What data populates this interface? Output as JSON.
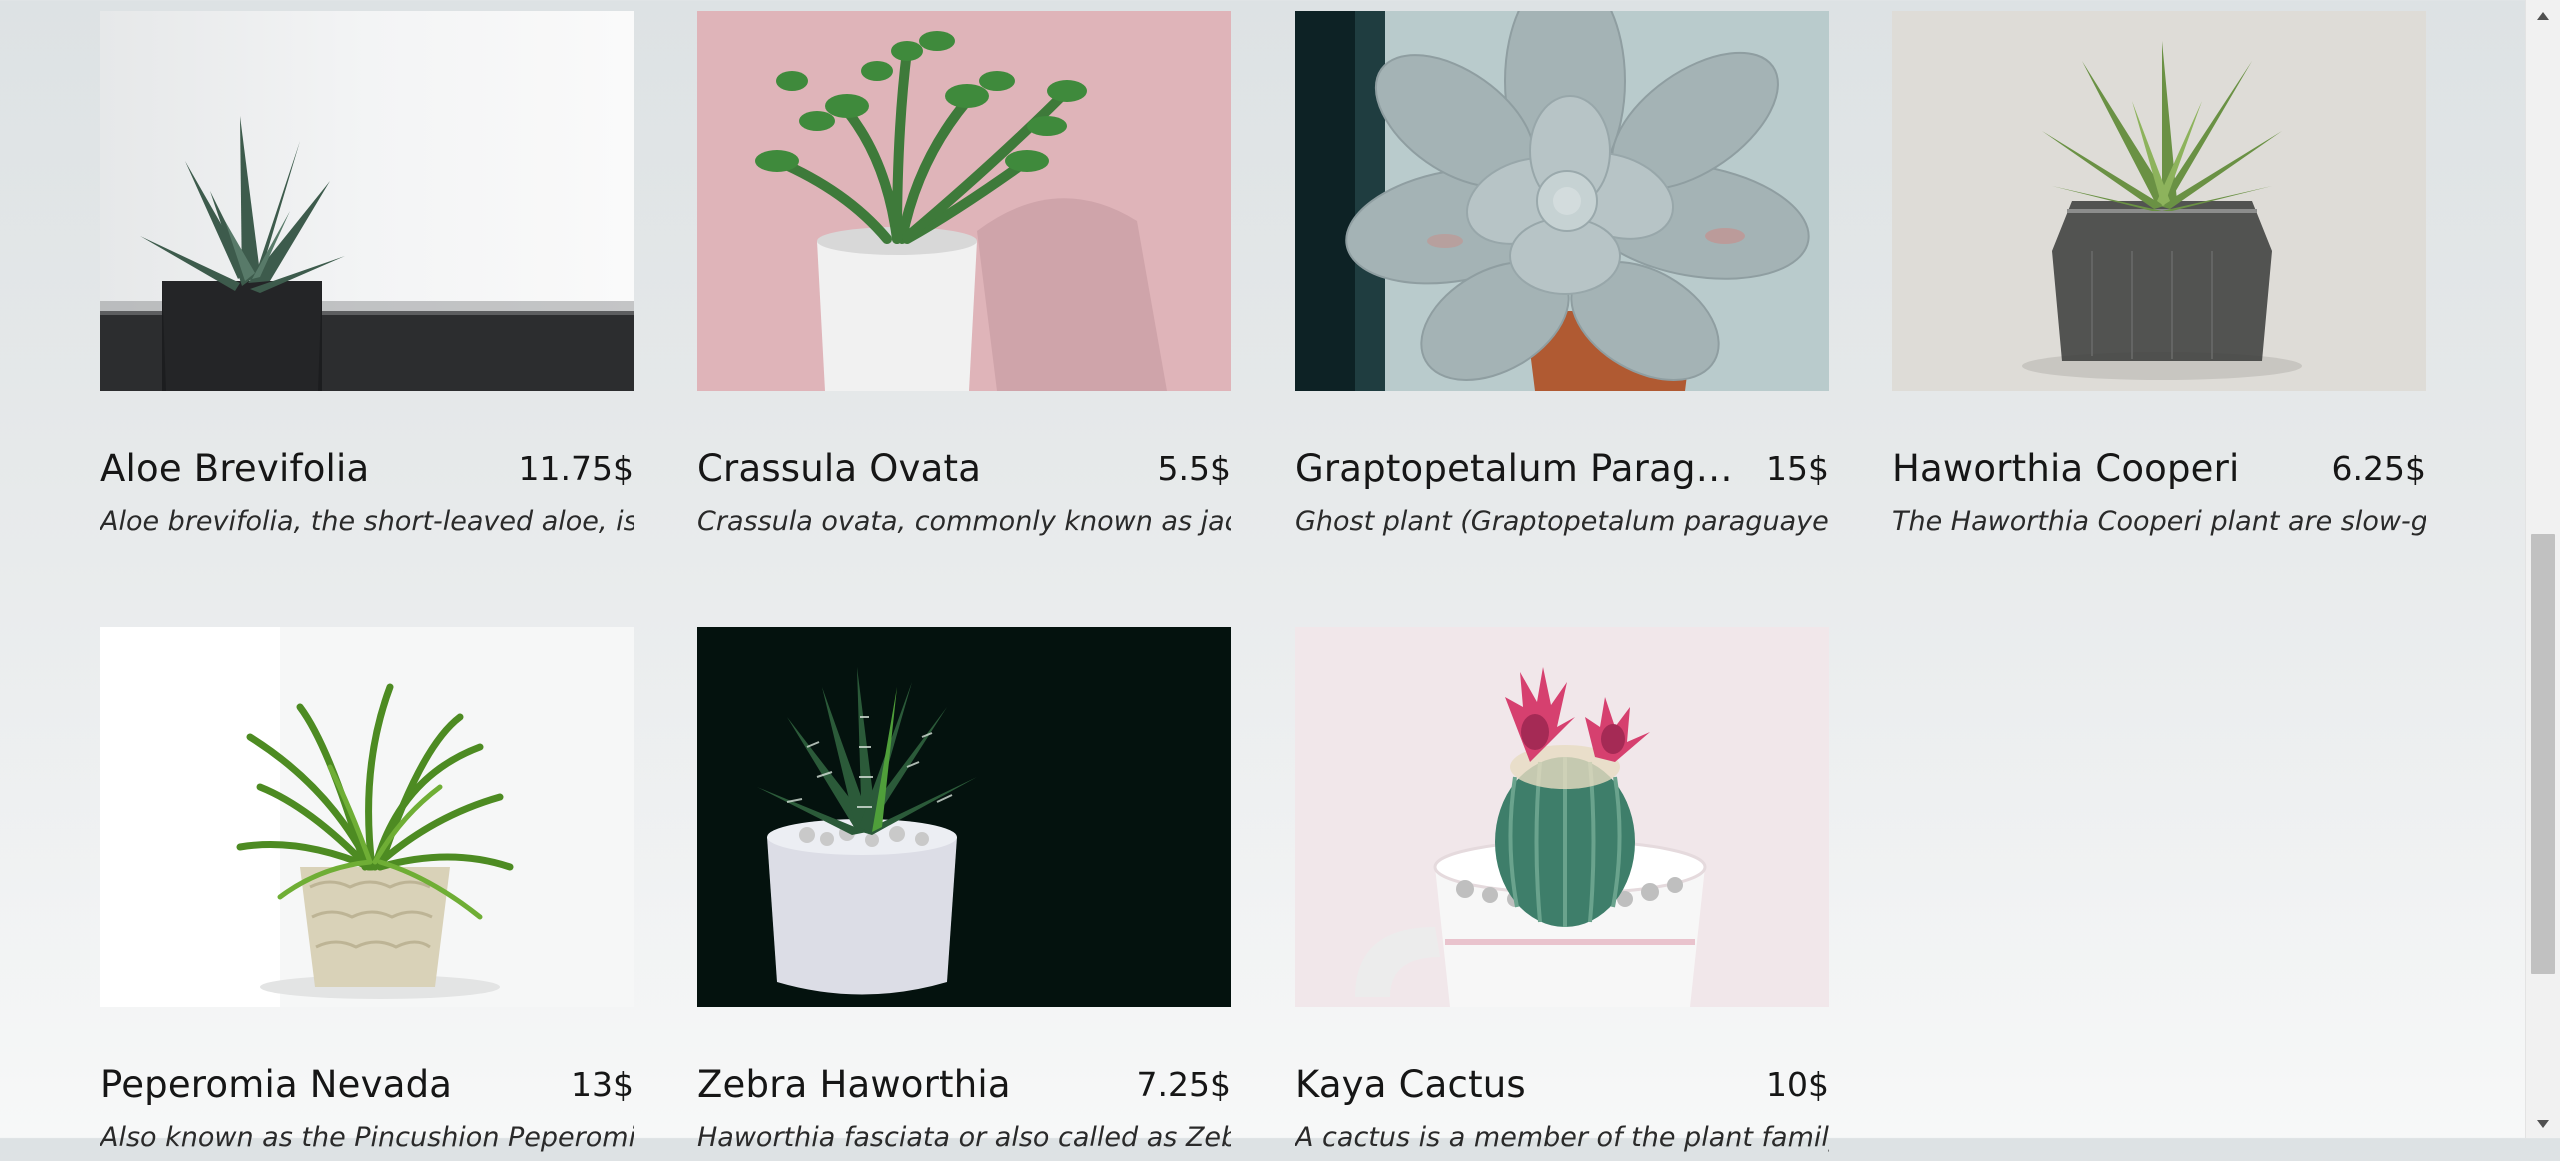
{
  "products": [
    {
      "name": "Aloe Brevifolia",
      "price": "11.75$",
      "description": "Aloe brevifolia, the short-leaved aloe, is ...",
      "image_alt": "aloe-plant-photo"
    },
    {
      "name": "Crassula Ovata",
      "price": "5.5$",
      "description": "Crassula ovata, commonly known as jad...",
      "image_alt": "jade-plant-photo"
    },
    {
      "name": "Graptopetalum Paraguay...",
      "price": "15$",
      "description": "Ghost plant (Graptopetalum paraguayen...",
      "image_alt": "ghost-plant-photo"
    },
    {
      "name": "Haworthia Cooperi",
      "price": "6.25$",
      "description": "The Haworthia Cooperi plant are slow-g...",
      "image_alt": "haworthia-cooperi-photo"
    },
    {
      "name": "Peperomia Nevada",
      "price": "13$",
      "description": "Also known as the Pincushion Peperomi...",
      "image_alt": "peperomia-photo"
    },
    {
      "name": "Zebra Haworthia",
      "price": "7.25$",
      "description": "Haworthia fasciata or also called as Zebr...",
      "image_alt": "zebra-haworthia-photo"
    },
    {
      "name": "Kaya Cactus",
      "price": "10$",
      "description": "A cactus is a member of the plant family ...",
      "image_alt": "cactus-photo"
    }
  ],
  "scrollbar": {
    "up_icon": "arrow-up-icon",
    "down_icon": "arrow-down-icon"
  },
  "colors": {
    "text": "#161616",
    "background_top": "#dde2e4",
    "background_bottom": "#f7f8f8"
  }
}
